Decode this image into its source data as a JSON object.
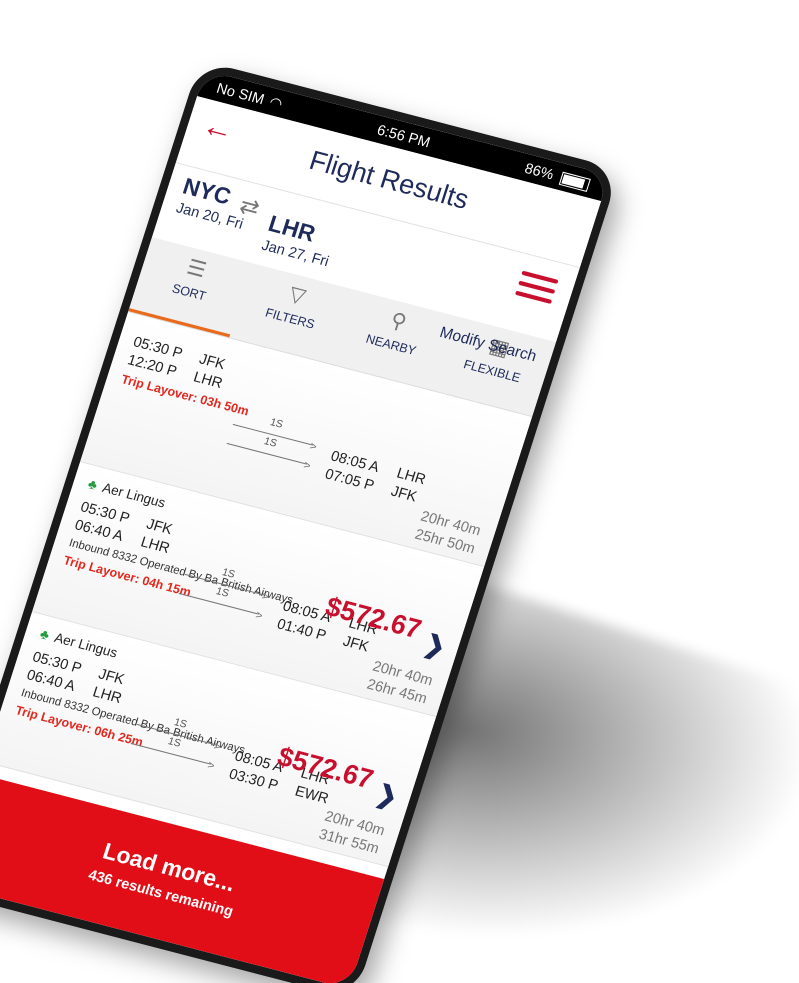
{
  "status_bar": {
    "carrier": "No SIM",
    "time": "6:56 PM",
    "battery": "86%"
  },
  "header": {
    "title": "Flight Results"
  },
  "route": {
    "origin_code": "NYC",
    "origin_date": "Jan 20, Fri",
    "destination_code": "LHR",
    "destination_date": "Jan 27, Fri"
  },
  "toolbar": {
    "sort": "SORT",
    "filters": "FILTERS",
    "nearby": "NEARBY",
    "flexible": "FLEXIBLE",
    "modify": "Modify Search"
  },
  "results": [
    {
      "airline": "",
      "dep1_time": "05:30 P",
      "dep1_airport": "JFK",
      "dep2_time": "12:20 P",
      "dep2_airport": "LHR",
      "stop1": "1S",
      "stop2": "1S",
      "arr1_time": "08:05 A",
      "arr1_airport": "LHR",
      "arr2_time": "07:05 P",
      "arr2_airport": "JFK",
      "duration1": "20hr 40m",
      "duration2": "25hr 50m",
      "price": "",
      "operated": "",
      "layover": "Trip Layover: 03h 50m"
    },
    {
      "airline": "Aer Lingus",
      "dep1_time": "05:30 P",
      "dep1_airport": "JFK",
      "dep2_time": "06:40 A",
      "dep2_airport": "LHR",
      "stop1": "1S",
      "stop2": "1S",
      "arr1_time": "08:05 A",
      "arr1_airport": "LHR",
      "arr2_time": "01:40 P",
      "arr2_airport": "JFK",
      "duration1": "20hr 40m",
      "duration2": "26hr 45m",
      "price": "$572.67",
      "operated": "Inbound 8332 Operated By Ba British Airways",
      "layover": "Trip Layover: 04h 15m"
    },
    {
      "airline": "Aer Lingus",
      "dep1_time": "05:30 P",
      "dep1_airport": "JFK",
      "dep2_time": "06:40 A",
      "dep2_airport": "LHR",
      "stop1": "1S",
      "stop2": "1S",
      "arr1_time": "08:05 A",
      "arr1_airport": "LHR",
      "arr2_time": "03:30 P",
      "arr2_airport": "EWR",
      "duration1": "20hr 40m",
      "duration2": "31hr 55m",
      "price": "$572.67",
      "operated": "Inbound 8332 Operated By Ba British Airways",
      "layover": "Trip Layover: 06h 25m"
    }
  ],
  "load_more": {
    "title": "Load more...",
    "subtitle": "436 results remaining"
  },
  "colors": {
    "brand_red": "#e10e17",
    "navy": "#1e2b5a",
    "accent_orange": "#e86a1d"
  }
}
